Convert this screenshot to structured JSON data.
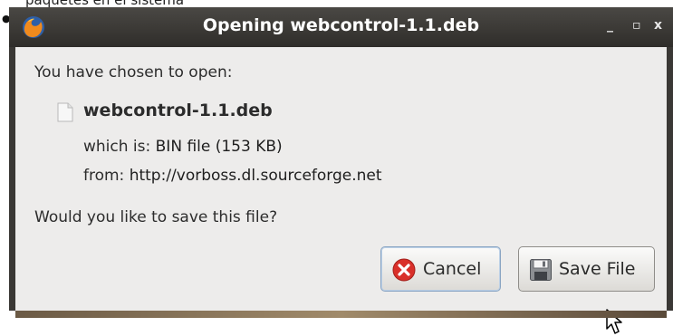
{
  "page": {
    "cut_text": "paquetes en el sistema"
  },
  "dialog": {
    "title": "Opening webcontrol-1.1.deb",
    "intro": "You have chosen to open:",
    "filename": "webcontrol-1.1.deb",
    "which_label": "which is:",
    "which_value": "BIN file (153 KB)",
    "from_label": "from:",
    "from_value": "http://vorboss.dl.sourceforge.net",
    "question": "Would you like to save this file?",
    "buttons": {
      "cancel": "Cancel",
      "save": "Save File"
    },
    "window_controls": {
      "minimize": "_",
      "maximize": "▫",
      "close": "x"
    }
  },
  "icons": {
    "app": "firefox-icon",
    "file": "file-icon",
    "cancel": "cancel-icon",
    "save": "floppy-disk-icon",
    "cursor": "mouse-pointer-icon"
  },
  "colors": {
    "titlebar": "#3a3835",
    "dialog_bg": "#edeceb",
    "cancel_icon": "#d9302a",
    "focus_border": "#8aa5c3"
  }
}
